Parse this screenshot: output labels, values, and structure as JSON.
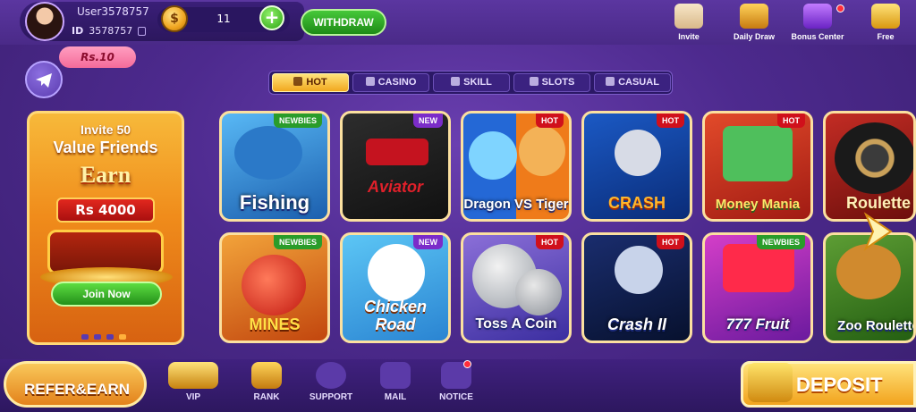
{
  "user": {
    "name": "User3578757",
    "id_label": "ID",
    "id": "3578757",
    "balance": "11"
  },
  "header": {
    "withdraw_label": "WITHDRAW",
    "coin_glyph": "$",
    "plus_glyph": "+",
    "icons": [
      {
        "name": "invite-icon",
        "label": "Invite"
      },
      {
        "name": "daily-draw-icon",
        "label": "Daily Draw"
      },
      {
        "name": "bonus-center-icon",
        "label": "Bonus Center"
      },
      {
        "name": "free-icon",
        "label": "Free"
      }
    ]
  },
  "telegram_reward": "Rs.10",
  "tabs": [
    {
      "label": "HOT",
      "active": true
    },
    {
      "label": "CASINO",
      "active": false
    },
    {
      "label": "SKILL",
      "active": false
    },
    {
      "label": "SLOTS",
      "active": false
    },
    {
      "label": "CASUAL",
      "active": false
    }
  ],
  "invite_card": {
    "line1": "Invite 50",
    "line2": "Value Friends",
    "line3": "Earn",
    "amount": "Rs 4000",
    "button": "Join Now"
  },
  "games_row1": [
    {
      "title": "Fishing",
      "badge": "NEWBIES",
      "badge_type": "newbies"
    },
    {
      "title": "Aviator",
      "badge": "NEW",
      "badge_type": "new"
    },
    {
      "title": "Dragon VS Tiger",
      "badge": "HOT",
      "badge_type": "hot"
    },
    {
      "title": "CRASH",
      "badge": "HOT",
      "badge_type": "hot"
    },
    {
      "title": "Money Mania",
      "badge": "HOT",
      "badge_type": "hot"
    },
    {
      "title": "Roulette",
      "badge": "",
      "badge_type": ""
    }
  ],
  "games_row2": [
    {
      "title": "MINES",
      "badge": "NEWBIES",
      "badge_type": "newbies"
    },
    {
      "title": "Chicken Road",
      "badge": "NEW",
      "badge_type": "new"
    },
    {
      "title": "Toss A Coin",
      "badge": "HOT",
      "badge_type": "hot"
    },
    {
      "title": "Crash II",
      "badge": "HOT",
      "badge_type": "hot"
    },
    {
      "title": "777 Fruit",
      "badge": "NEWBIES",
      "badge_type": "newbies"
    },
    {
      "title": "Zoo Roulette",
      "badge": "",
      "badge_type": ""
    }
  ],
  "bottom_nav": {
    "refer": "REFER&EARN",
    "vip": "VIP",
    "rank": "RANK",
    "support": "SUPPORT",
    "mail": "MAIL",
    "notice": "NOTICE",
    "deposit": "DEPOSIT"
  },
  "colors": {
    "background": "#4d2a8e",
    "accent_green": "#2ea513",
    "accent_gold": "#f1a81f",
    "hot_badge": "#d0101b"
  }
}
